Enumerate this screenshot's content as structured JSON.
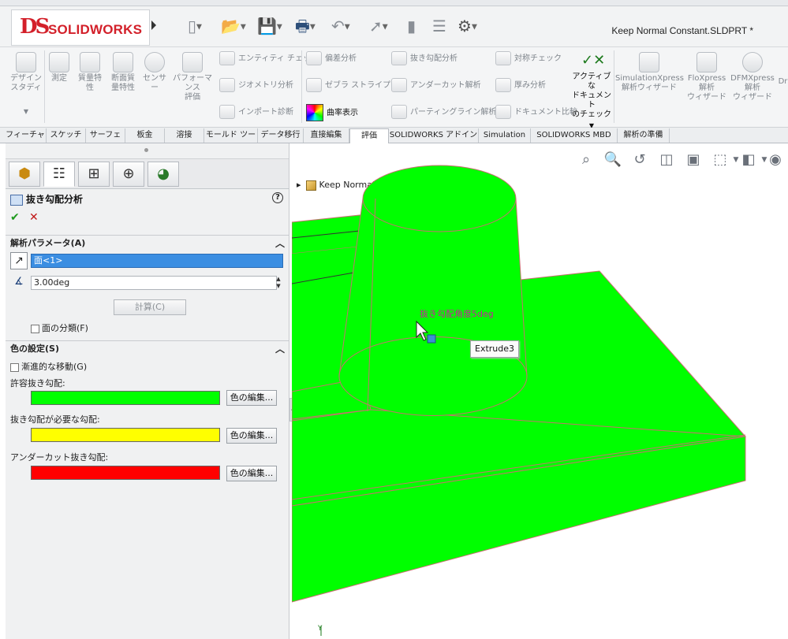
{
  "app": {
    "logo_mark": "DS",
    "logo_text": "SOLIDWORKS",
    "document_title": "Keep Normal Constant.SLDPRT *"
  },
  "quick_access": {
    "icons": [
      "new-document-icon",
      "open-icon",
      "save-icon",
      "print-icon",
      "undo-icon",
      "select-icon",
      "rebuild-icon",
      "file-properties-icon",
      "options-gear-icon"
    ]
  },
  "ribbon": {
    "large_buttons": [
      {
        "label": "デザイン\nスタディ"
      },
      {
        "label": "測定"
      },
      {
        "label": "質量特\n性"
      },
      {
        "label": "断面質\n量特性"
      },
      {
        "label": "センサー"
      },
      {
        "label": "パフォーマンス\n評価"
      }
    ],
    "col1": [
      "エンティティ チェック",
      "ジオメトリ分析",
      "インポート診断"
    ],
    "col2": [
      "偏差分析",
      "ゼブラ ストライプ",
      "曲率表示"
    ],
    "col3": [
      "抜き勾配分析",
      "アンダーカット解析",
      "パーティングライン解析"
    ],
    "col4": [
      "対称チェック",
      "厚み分析",
      "ドキュメント比較"
    ],
    "active_doc_check": "アクティブな\nドキュメント\nのチェック",
    "addins": [
      {
        "label": "SimulationXpress\n解析ウィザード"
      },
      {
        "label": "FloXpress\n解析\nウィザード"
      },
      {
        "label": "DFMXpress\n解析\nウィザード"
      },
      {
        "label": "Dr"
      }
    ]
  },
  "tabs": [
    {
      "label": "フィーチャー"
    },
    {
      "label": "スケッチ"
    },
    {
      "label": "サーフェス"
    },
    {
      "label": "板金"
    },
    {
      "label": "溶接"
    },
    {
      "label": "モールド ツール"
    },
    {
      "label": "データ移行"
    },
    {
      "label": "直接編集"
    },
    {
      "label": "評価",
      "active": true
    },
    {
      "label": "SOLIDWORKS アドイン"
    },
    {
      "label": "Simulation"
    },
    {
      "label": "SOLIDWORKS MBD"
    },
    {
      "label": "解析の準備"
    }
  ],
  "property_manager": {
    "title": "抜き勾配分析",
    "ok_symbol": "✔",
    "cancel_symbol": "✕",
    "help_symbol": "?",
    "section_params": "解析パラメータ(A)",
    "face_value": "面<1>",
    "draft_angle": "3.00deg",
    "calc_button": "計算(C)",
    "face_classify": "面の分類(F)",
    "section_color": "色の設定(S)",
    "gradual": "漸進的な移動(G)",
    "colors": [
      {
        "label": "許容抜き勾配:",
        "color": "#00ff00",
        "button": "色の編集..."
      },
      {
        "label": "抜き勾配が必要な勾配:",
        "color": "#ffff00",
        "button": "色の編集..."
      },
      {
        "label": "アンダーカット抜き勾配:",
        "color": "#ff0000",
        "button": "色の編集..."
      }
    ]
  },
  "viewport": {
    "tree_item": "Keep Normal Constant...",
    "tooltip": "Extrude3",
    "annotation": "抜き勾配角度5deg",
    "model_color": "#00ff00",
    "edge_color": "#c87070"
  }
}
